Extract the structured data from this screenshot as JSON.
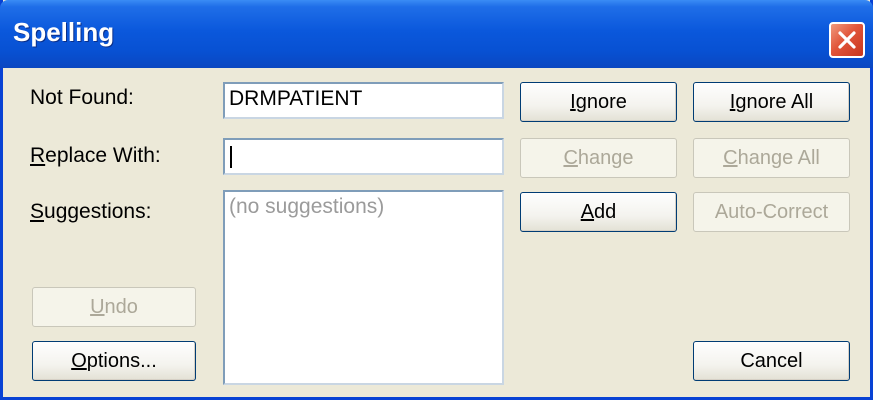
{
  "window": {
    "title": "Spelling"
  },
  "labels": {
    "not_found": "Not Found:",
    "replace_with": "Replace With:",
    "suggestions": "Suggestions:"
  },
  "fields": {
    "not_found_value": "DRMPATIENT",
    "replace_with_value": "",
    "suggestions_placeholder": "(no suggestions)"
  },
  "buttons": {
    "ignore": "Ignore",
    "ignore_all": "Ignore All",
    "change": "Change",
    "change_all": "Change All",
    "add": "Add",
    "auto_correct": "Auto-Correct",
    "undo": "Undo",
    "options": "Options...",
    "cancel": "Cancel"
  },
  "colors": {
    "title_bar": "#0b58dc",
    "close_button": "#e1553a",
    "dialog_background": "#ece9d8",
    "disabled_text": "#aca899"
  },
  "icons": {
    "close": "close-x-icon"
  }
}
